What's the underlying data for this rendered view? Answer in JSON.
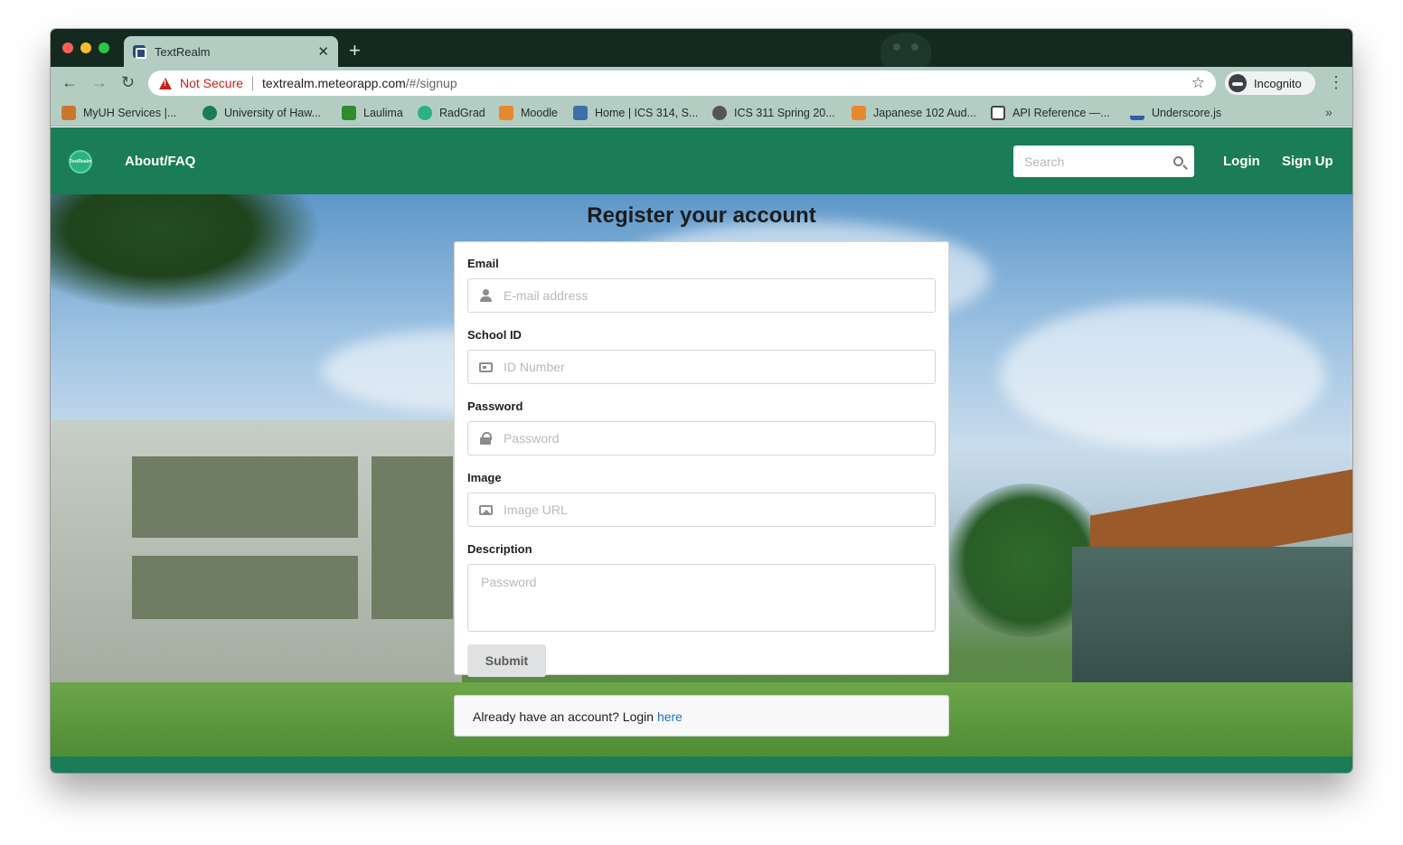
{
  "browser": {
    "tab_title": "TextRealm",
    "not_secure": "Not Secure",
    "url_host": "textrealm.meteorapp.com",
    "url_path": "/#/signup",
    "incognito": "Incognito",
    "bookmarks": [
      {
        "label": "MyUH Services |...",
        "color": "#c9772c"
      },
      {
        "label": "University of Haw...",
        "color": "#1a7d57"
      },
      {
        "label": "Laulima",
        "color": "#2e8b2e"
      },
      {
        "label": "RadGrad",
        "color": "#2bb184"
      },
      {
        "label": "Moodle",
        "color": "#e8872d"
      },
      {
        "label": "Home | ICS 314, S...",
        "color": "#3d6fa8"
      },
      {
        "label": "ICS 311 Spring 20...",
        "color": "#555555"
      },
      {
        "label": "Japanese 102 Aud...",
        "color": "#e8872d"
      },
      {
        "label": "API Reference —...",
        "color": "#444444"
      },
      {
        "label": "Underscore.js",
        "color": "#2b5fa8"
      }
    ]
  },
  "navbar": {
    "logo_text": "TextRealm",
    "about": "About/FAQ",
    "search_placeholder": "Search",
    "login": "Login",
    "signup": "Sign Up",
    "brand_color": "#1a7d57"
  },
  "form": {
    "title": "Register your account",
    "email_label": "Email",
    "email_placeholder": "E-mail address",
    "school_id_label": "School ID",
    "school_id_placeholder": "ID Number",
    "password_label": "Password",
    "password_placeholder": "Password",
    "image_label": "Image",
    "image_placeholder": "Image URL",
    "description_label": "Description",
    "description_placeholder": "Password",
    "submit": "Submit"
  },
  "login_message": {
    "text": "Already have an account? Login ",
    "link": "here"
  }
}
